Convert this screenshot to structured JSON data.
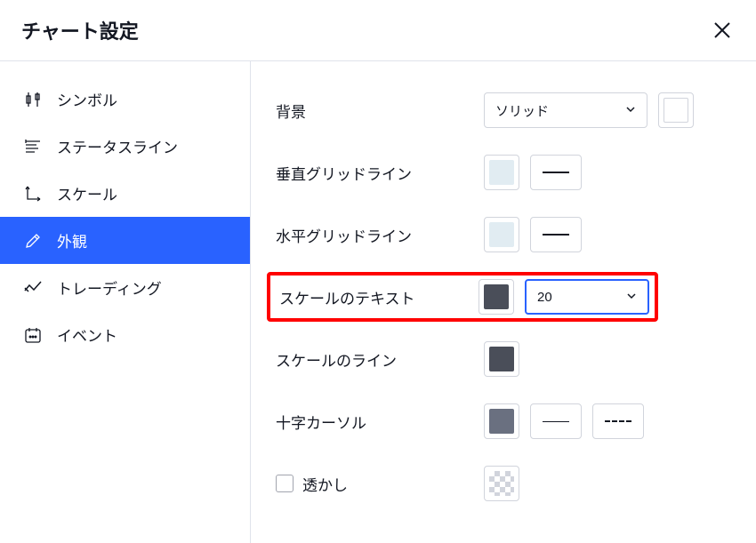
{
  "header": {
    "title": "チャート設定"
  },
  "sidebar": {
    "items": [
      {
        "label": "シンボル"
      },
      {
        "label": "ステータスライン"
      },
      {
        "label": "スケール"
      },
      {
        "label": "外観"
      },
      {
        "label": "トレーディング"
      },
      {
        "label": "イベント"
      }
    ]
  },
  "settings": {
    "background": {
      "label": "背景",
      "type_value": "ソリッド",
      "color": "#ffffff"
    },
    "vgrid": {
      "label": "垂直グリッドライン",
      "color": "#e1ecf2"
    },
    "hgrid": {
      "label": "水平グリッドライン",
      "color": "#e1ecf2"
    },
    "scale_text": {
      "label": "スケールのテキスト",
      "color": "#4a4e59",
      "size": "20"
    },
    "scale_line": {
      "label": "スケールのライン",
      "color": "#4a4e59"
    },
    "crosshair": {
      "label": "十字カーソル",
      "color": "#6a7080"
    },
    "watermark": {
      "label": "透かし"
    }
  }
}
